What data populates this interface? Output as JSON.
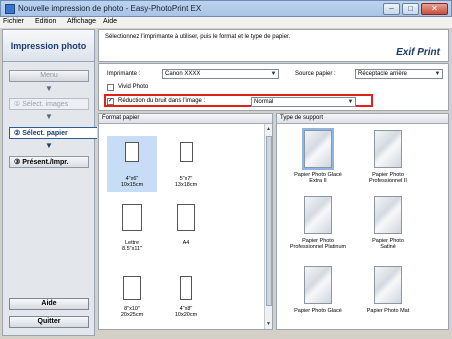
{
  "window": {
    "title": "Nouvelle impression de photo - Easy-PhotoPrint EX"
  },
  "menu": [
    "Fichier",
    "Edition",
    "Affichage",
    "Aide"
  ],
  "sidebar": {
    "header": "Impression photo",
    "menu_button": "Menu",
    "steps": [
      "①  Sélect. images",
      "②  Sélect. papier",
      "③  Présent./Impr."
    ],
    "help": "Aide",
    "quit": "Quitter"
  },
  "instruction": "Sélectionnez l'imprimante à utiliser, puis le format et le type de papier.",
  "logo": "Exif Print",
  "settings": {
    "printer_label": "Imprimante :",
    "printer_value": "Canon XXXX",
    "source_label": "Source papier :",
    "source_value": "Réceptacle arrière",
    "vivid_label": "Vivid Photo",
    "vivid_checked": false,
    "noise_label": "Réduction du bruit dans l'image :",
    "noise_checked": true,
    "noise_value": "Normal"
  },
  "paper_size": {
    "header": "Format papier",
    "items": [
      {
        "line1": "4\"x6\"",
        "line2": "10x15cm"
      },
      {
        "line1": "5\"x7\"",
        "line2": "13x18cm"
      },
      {
        "line1": "Lettre",
        "line2": "8.5\"x11\""
      },
      {
        "line1": "A4",
        "line2": ""
      },
      {
        "line1": "8\"x10\"",
        "line2": "20x25cm"
      },
      {
        "line1": "4\"x8\"",
        "line2": "10x20cm"
      }
    ]
  },
  "media_type": {
    "header": "Type de support",
    "items": [
      {
        "line1": "Papier Photo Glacé",
        "line2": "Extra II"
      },
      {
        "line1": "Papier Photo",
        "line2": "Professionnel II"
      },
      {
        "line1": "Papier Photo",
        "line2": "Professionnel Platinum"
      },
      {
        "line1": "Papier Photo",
        "line2": "Satiné"
      },
      {
        "line1": "Papier Photo Glacé",
        "line2": ""
      },
      {
        "line1": "Papier Photo Mat",
        "line2": ""
      }
    ]
  }
}
